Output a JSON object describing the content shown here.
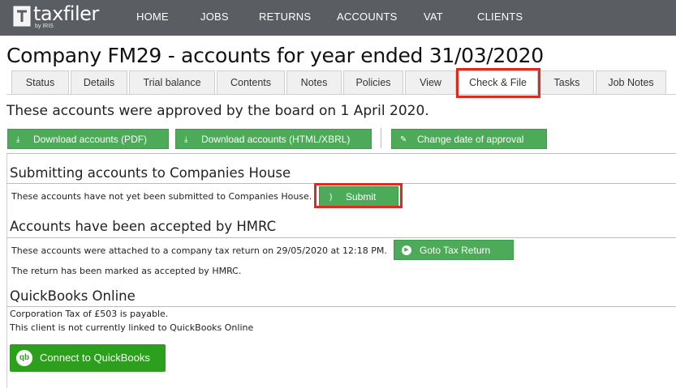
{
  "brand": {
    "name": "taxfiler",
    "sub": "by IRIS",
    "accent": "#4caa58",
    "nav_bg": "#5a5d62",
    "highlight": "#e02a1f"
  },
  "nav": [
    "HOME",
    "JOBS",
    "RETURNS",
    "ACCOUNTS",
    "VAT",
    "CLIENTS"
  ],
  "page_title": "Company FM29 - accounts for year ended 31/03/2020",
  "tabs": [
    "Status",
    "Details",
    "Trial balance",
    "Contents",
    "Notes",
    "Policies",
    "View",
    "Check & File",
    "Tasks",
    "Job Notes"
  ],
  "active_tab": "Check & File",
  "approved_text": "These accounts were approved by the board on 1 April 2020.",
  "toolbar": {
    "download_pdf": "Download accounts (PDF)",
    "download_html": "Download accounts (HTML/XBRL)",
    "change_date": "Change date of approval"
  },
  "companies_house": {
    "title": "Submitting accounts to Companies House",
    "status": "These accounts have not yet been submitted to Companies House.",
    "submit_label": "Submit"
  },
  "hmrc": {
    "title": "Accounts have been accepted by HMRC",
    "attached": "These accounts were attached to a company tax return on 29/05/2020 at 12:18 PM.",
    "goto_label": "Goto Tax Return",
    "accepted": "The return has been marked as accepted by HMRC."
  },
  "quickbooks": {
    "title": "QuickBooks Online",
    "tax_line": "Corporation Tax of £503 is payable.",
    "link_line": "This client is not currently linked to QuickBooks Online",
    "connect_label": "Connect to QuickBooks",
    "logo_text": "qb"
  }
}
